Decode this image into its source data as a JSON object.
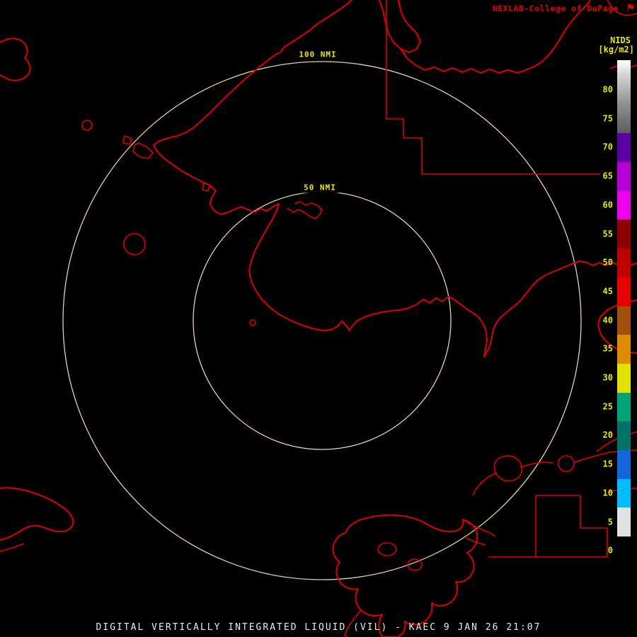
{
  "header": {
    "brand": "NEXLAB-College of DuPage",
    "flag_icon": "⚑"
  },
  "scale": {
    "title": "NIDS",
    "units": "[kg/m2]",
    "ticks": [
      "80",
      "75",
      "70",
      "65",
      "60",
      "55",
      "50",
      "45",
      "40",
      "35",
      "30",
      "25",
      "20",
      "15",
      "10",
      "5",
      "0"
    ],
    "segments": [
      {
        "value": "top",
        "color": "linear-gradient(180deg,#ffffff,#d2d2d2)"
      },
      {
        "value": "80",
        "color": "linear-gradient(180deg,#d2d2d2,#8f8f8f)"
      },
      {
        "value": "75",
        "color": "linear-gradient(180deg,#8f8f8f,#5c5c5c)"
      },
      {
        "value": "70",
        "color": "#5a00a0"
      },
      {
        "value": "65",
        "color": "#b400d2"
      },
      {
        "value": "60",
        "color": "#ee00ee"
      },
      {
        "value": "55",
        "color": "#8c0000"
      },
      {
        "value": "50",
        "color": "#be0000"
      },
      {
        "value": "45",
        "color": "#e60000"
      },
      {
        "value": "40",
        "color": "#a0500a"
      },
      {
        "value": "35",
        "color": "#dc8c00"
      },
      {
        "value": "30",
        "color": "#e1e100"
      },
      {
        "value": "25",
        "color": "#00a577"
      },
      {
        "value": "20",
        "color": "#007364"
      },
      {
        "value": "15",
        "color": "#1464dc"
      },
      {
        "value": "10",
        "color": "#00bdff"
      },
      {
        "value": "5",
        "color": "#e1e1e1"
      },
      {
        "value": "0",
        "color": "#000000"
      }
    ]
  },
  "map": {
    "outer_ring_label": "100 NMI",
    "inner_ring_label": "50 NMI"
  },
  "caption": "DIGITAL VERTICALLY INTEGRATED LIQUID (VIL) - KAEC 9 JAN 26 21:07",
  "colors": {
    "background": "#000000",
    "coastline": "#dd0000",
    "range_ring": "#e9d2a2",
    "label_yellow": "#e9e900",
    "brand_red": "#e60000",
    "caption_white": "#ebebeb"
  }
}
